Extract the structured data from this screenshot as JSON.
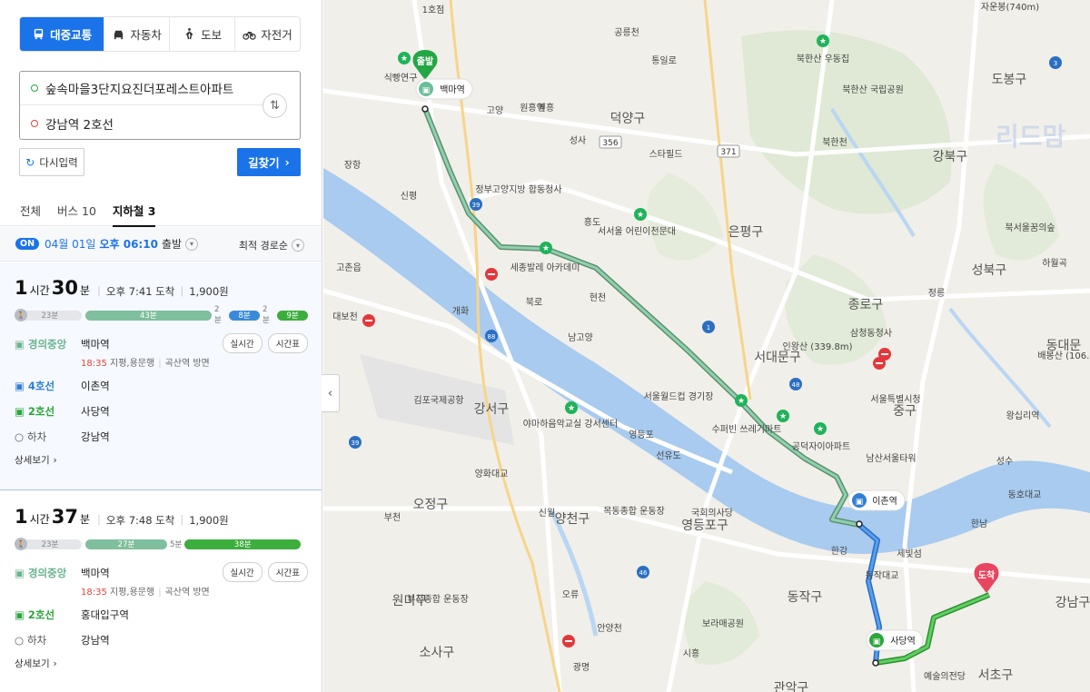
{
  "modes": [
    {
      "label": "대중교통",
      "icon": "bus-icon",
      "active": true
    },
    {
      "label": "자동차",
      "icon": "car-icon"
    },
    {
      "label": "도보",
      "icon": "walk-icon"
    },
    {
      "label": "자전거",
      "icon": "bicycle-icon"
    }
  ],
  "route": {
    "origin": "숲속마을3단지요진더포레스트아파트",
    "destination": "강남역 2호선",
    "reset_label": "다시입력",
    "find_label": "길찾기"
  },
  "tabs": [
    "전체",
    "버스 10",
    "지하철 3"
  ],
  "departure": {
    "badge": "ON",
    "date": "04월 01일",
    "time": "오후 06:10",
    "suffix": "출발",
    "sort": "최적 경로순"
  },
  "results": [
    {
      "hours": "1",
      "hour_unit": "시간",
      "minutes": "30",
      "min_unit": "분",
      "arrival": "오후 7:41 도착",
      "fare": "1,900원",
      "segments": {
        "walk1": "23분",
        "teal": "43분",
        "gap1": "2분",
        "blue": "8분",
        "gap2": "2분",
        "green": "9분"
      },
      "steps": [
        {
          "line": "경의중앙",
          "station": "백마역",
          "sub_time": "18:35",
          "sub_text": "지평,용문행",
          "sub_dir": "곡산역 방면",
          "btn1": "실시간",
          "btn2": "시간표"
        },
        {
          "line": "4호선",
          "station": "이촌역"
        },
        {
          "line": "2호선",
          "station": "사당역"
        },
        {
          "line": "하차",
          "station": "강남역"
        }
      ],
      "detail": "상세보기"
    },
    {
      "hours": "1",
      "hour_unit": "시간",
      "minutes": "37",
      "min_unit": "분",
      "arrival": "오후 7:48 도착",
      "fare": "1,900원",
      "segments": {
        "walk1": "23분",
        "teal": "27분",
        "gap1": "5분",
        "green": "38분"
      },
      "steps": [
        {
          "line": "경의중앙",
          "station": "백마역",
          "sub_time": "18:35",
          "sub_text": "지평,용문행",
          "sub_dir": "곡산역 방면",
          "btn1": "실시간",
          "btn2": "시간표"
        },
        {
          "line": "2호선",
          "station": "홍대입구역"
        },
        {
          "line": "하차",
          "station": "강남역"
        }
      ],
      "detail": "상세보기"
    }
  ],
  "map": {
    "start_label": "출발",
    "end_label": "도착",
    "stations": {
      "baekma": "백마역",
      "ichon": "이촌역",
      "sadang": "사당역"
    },
    "districts": [
      "덕양구",
      "은평구",
      "종로구",
      "서대문구",
      "강서구",
      "양천구",
      "영등포구",
      "동작구",
      "중구",
      "성북구",
      "강북구",
      "도봉구",
      "동대문",
      "서초구",
      "강남구",
      "오정구",
      "원미구",
      "소사구",
      "관악구"
    ],
    "places": [
      "식빵연구",
      "세종발레 아카데미",
      "서서울 어린이천문대",
      "수퍼빈 쓰레기마트",
      "공덕자이아파트",
      "야마하음악교실 강서센터",
      "북한산 우동집",
      "북한산 국립공원",
      "북한천",
      "스타필드",
      "김포국제공항",
      "서울월드컵 경기장",
      "국회의사당",
      "남산서울타워",
      "보라매공원",
      "예술의전당",
      "고촌읍",
      "원흥역",
      "정부고양지방 합동청사",
      "서울특별시청",
      "인왕산 (339.8m)",
      "북서울꿈의숲",
      "삼청동청사",
      "정릉",
      "배봉산 (106.03m)",
      "양화대교",
      "선유도",
      "한남",
      "동작대교",
      "세빛섬",
      "한강",
      "동호대교",
      "성수",
      "방화",
      "대보천",
      "1호점",
      "장항",
      "신평",
      "고양",
      "성사",
      "흥도",
      "현천",
      "개화",
      "북로",
      "남고양",
      "영등포",
      "신월",
      "부천",
      "목동종합 운동장",
      "부천종합 운동장",
      "안양천",
      "광명",
      "오류",
      "시흥",
      "통일로",
      "공릉천",
      "원흥",
      "자운봉(740m)",
      "하월곡",
      "왕십리역",
      "서울시청"
    ],
    "road_numbers": [
      "356",
      "371",
      "39",
      "88",
      "48",
      "46",
      "1",
      "3"
    ],
    "watermark": "리드맘"
  }
}
